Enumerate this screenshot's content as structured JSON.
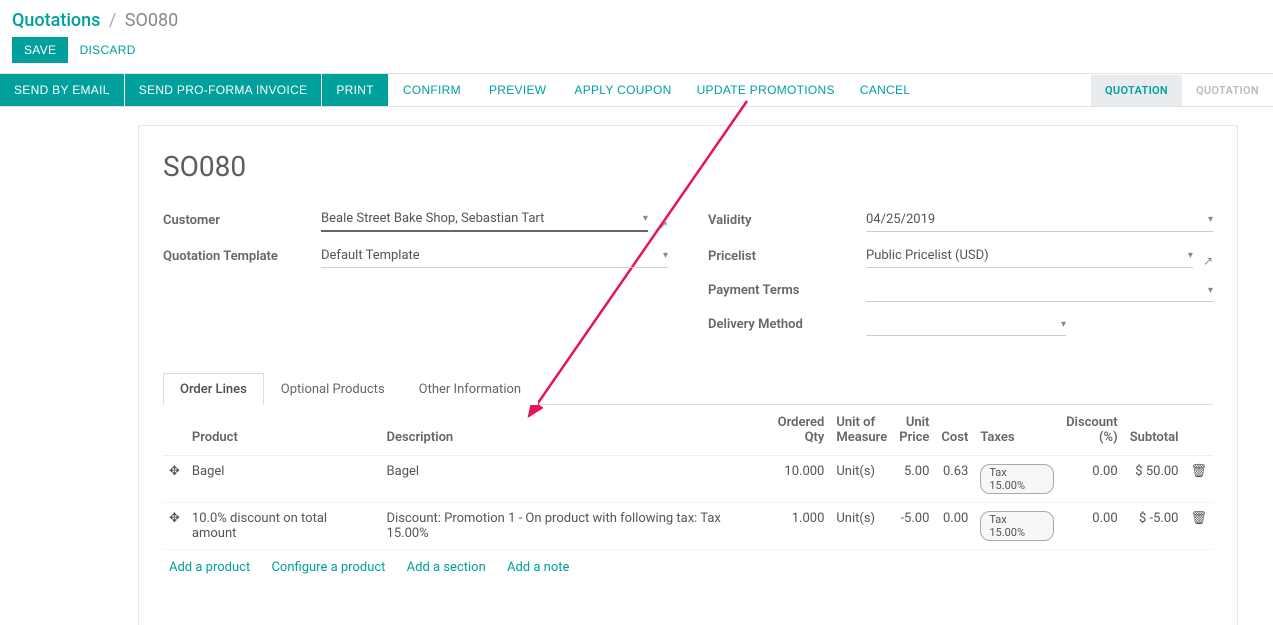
{
  "breadcrumb": {
    "root": "Quotations",
    "current": "SO080"
  },
  "topActions": {
    "save": "SAVE",
    "discard": "DISCARD"
  },
  "toolbar": {
    "sendEmail": "SEND BY EMAIL",
    "sendProForma": "SEND PRO-FORMA INVOICE",
    "print": "PRINT",
    "confirm": "CONFIRM",
    "preview": "PREVIEW",
    "applyCoupon": "APPLY COUPON",
    "updatePromotions": "UPDATE PROMOTIONS",
    "cancel": "CANCEL"
  },
  "status": {
    "quotation": "QUOTATION",
    "quotation2": "QUOTATION"
  },
  "record": {
    "name": "SO080",
    "labels": {
      "customer": "Customer",
      "quotationTemplate": "Quotation Template",
      "validity": "Validity",
      "pricelist": "Pricelist",
      "paymentTerms": "Payment Terms",
      "deliveryMethod": "Delivery Method"
    },
    "values": {
      "customer": "Beale Street Bake Shop, Sebastian Tart",
      "quotationTemplate": "Default Template",
      "validity": "04/25/2019",
      "pricelist": "Public Pricelist (USD)",
      "paymentTerms": "",
      "deliveryMethod": ""
    }
  },
  "tabs": {
    "orderLines": "Order Lines",
    "optionalProducts": "Optional Products",
    "otherInfo": "Other Information"
  },
  "tableHeaders": {
    "product": "Product",
    "description": "Description",
    "orderedQty": "Ordered\nQty",
    "uom": "Unit of\nMeasure",
    "unitPrice": "Unit\nPrice",
    "cost": "Cost",
    "taxes": "Taxes",
    "discount": "Discount\n(%)",
    "subtotal": "Subtotal"
  },
  "lines": [
    {
      "product": "Bagel",
      "description": "Bagel",
      "qty": "10.000",
      "uom": "Unit(s)",
      "price": "5.00",
      "cost": "0.63",
      "tax": "Tax 15.00%",
      "discount": "0.00",
      "subtotal": "$ 50.00"
    },
    {
      "product": "10.0% discount on total amount",
      "description": "Discount: Promotion 1 - On product with following tax: Tax 15.00%",
      "qty": "1.000",
      "uom": "Unit(s)",
      "price": "-5.00",
      "cost": "0.00",
      "tax": "Tax 15.00%",
      "discount": "0.00",
      "subtotal": "$ -5.00"
    }
  ],
  "addLinks": {
    "addProduct": "Add a product",
    "configureProduct": "Configure a product",
    "addSection": "Add a section",
    "addNote": "Add a note"
  }
}
